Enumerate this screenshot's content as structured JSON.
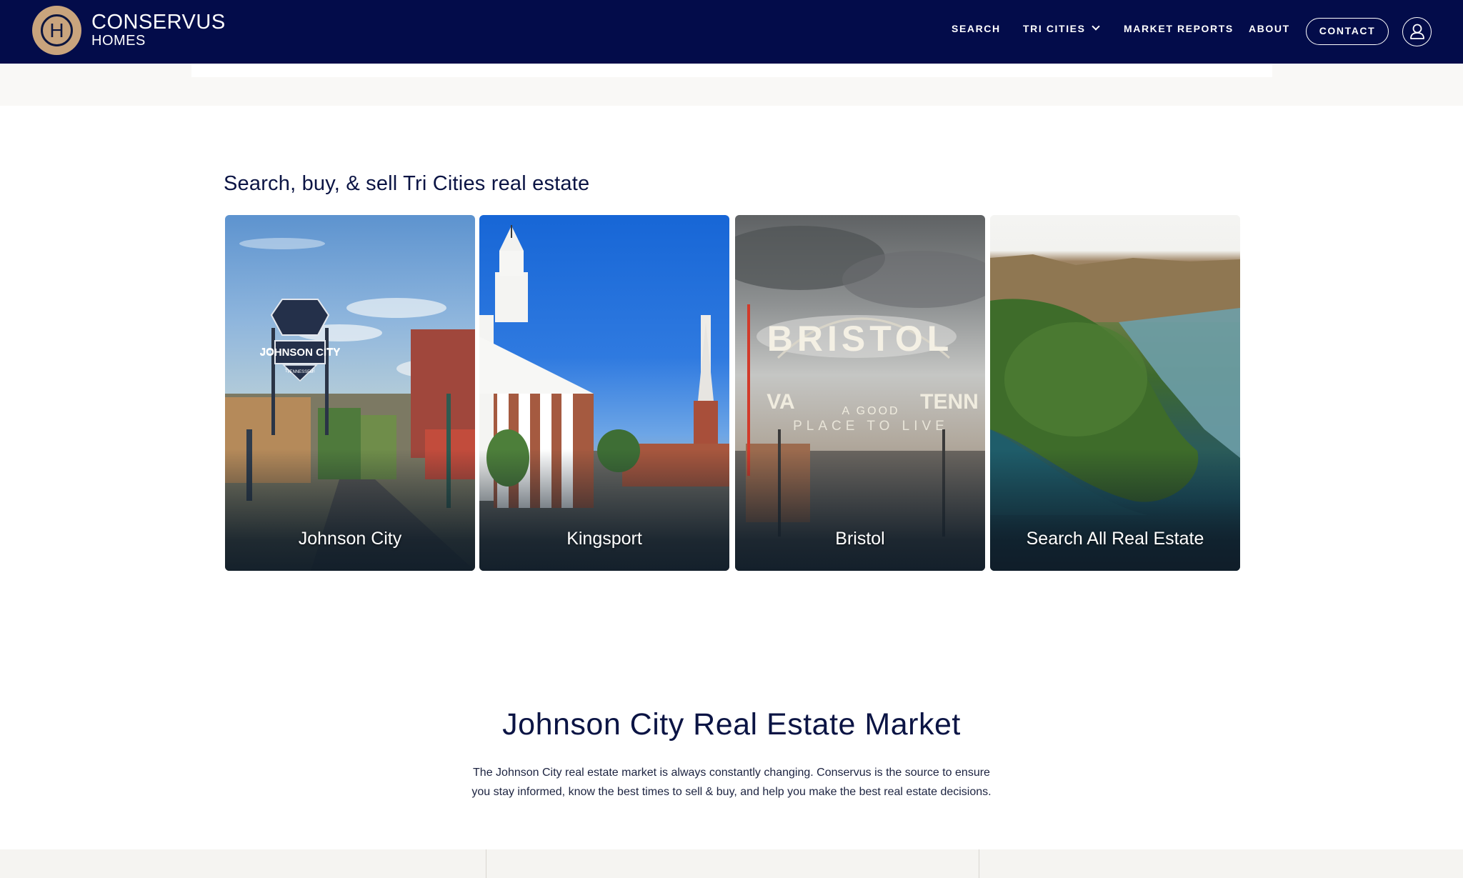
{
  "brand": {
    "name_line1": "CONSERVUS",
    "name_line2": "HOMES",
    "monogram": "H"
  },
  "nav": {
    "items": [
      {
        "label": "SEARCH"
      },
      {
        "label": "TRI CITIES"
      },
      {
        "label": "MARKET REPORTS"
      },
      {
        "label": "ABOUT"
      }
    ],
    "contact_label": "CONTACT"
  },
  "search_section": {
    "title": "Search, buy, & sell Tri Cities real estate",
    "cards": [
      {
        "label": "Johnson City"
      },
      {
        "label": "Kingsport"
      },
      {
        "label": "Bristol"
      },
      {
        "label": "Search All Real Estate"
      }
    ]
  },
  "market_section": {
    "title": "Johnson City Real Estate Market",
    "description": "The Johnson City real estate market is always constantly changing. Conservus is the source to ensure you stay informed, know the best times to sell & buy, and help you make the best real estate decisions."
  },
  "image_text": {
    "johnson_city_sign": "JOHNSON CITY",
    "johnson_city_sign_sub": "TENNESSEE",
    "bristol_sign_main": "BRISTOL",
    "bristol_sign_left": "VA",
    "bristol_sign_right": "TENN",
    "bristol_sign_line1": "A GOOD",
    "bristol_sign_line2": "PLACE TO LIVE"
  },
  "colors": {
    "header_bg": "#030c4a",
    "logo_gold": "#c9a47d",
    "text_navy": "#0b1444"
  }
}
